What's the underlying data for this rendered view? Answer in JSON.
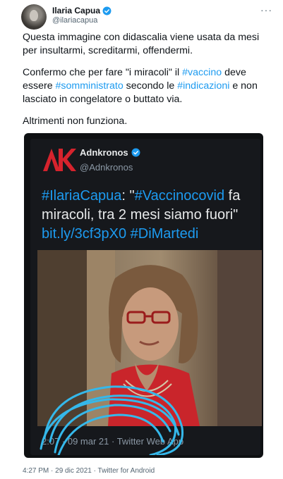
{
  "author": {
    "name": "Ilaria Capua",
    "handle": "@ilariacapua",
    "more_label": "···"
  },
  "tweet": {
    "p1": "Questa immagine con didascalia viene usata da mesi per insultarmi, screditarmi, offendermi.",
    "p2": {
      "t1": "Confermo che per fare \"i miracoli\" il ",
      "tag1": "#vaccino",
      "t2": " deve essere ",
      "tag2": "#somministrato",
      "t3": " secondo le ",
      "tag3": "#indicazioni",
      "t4": " e non lasciato in congelatore o buttato via."
    },
    "p3": "Altrimenti non funziona."
  },
  "embed": {
    "source_name": "Adnkronos",
    "source_handle": "@Adnkronos",
    "tag_ilaria": "#IlariaCapua",
    "colon": ": \"",
    "tag_vaccino": "#Vaccinocovid",
    "text_rest": " fa miracoli, tra 2 mesi siamo fuori\"",
    "link": "bit.ly/3cf3pX0",
    "tag_dimartedi": "#DiMartedi",
    "meta": "2:07 · 09 mar 21 · Twitter Web App"
  },
  "footer": "4:27 PM · 29 dic 2021 · Twitter for Android",
  "colors": {
    "link": "#1d9bf0",
    "verified": "#1d9bf0",
    "brand_red": "#d6232d",
    "scribble": "#35b8ea"
  }
}
